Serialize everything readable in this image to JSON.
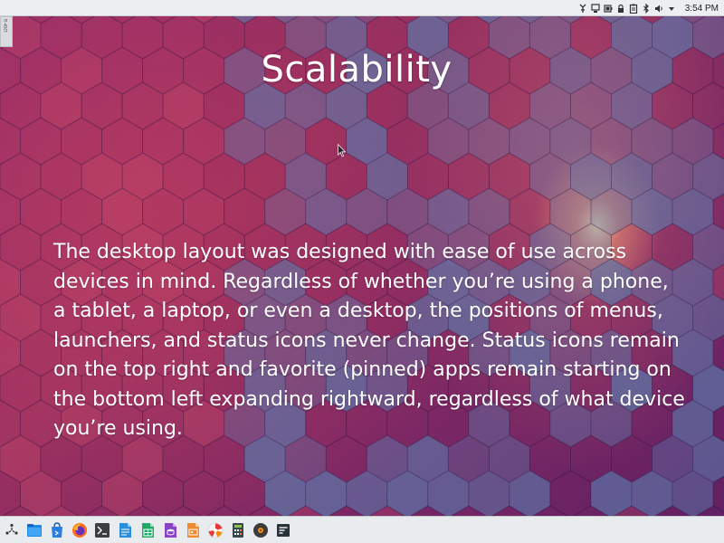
{
  "slide": {
    "title": "Scalability",
    "body": "The desktop layout was designed with ease of use across devices in mind. Regardless of whether you’re using a phone, a tablet, a laptop, or even a desktop, the positions of menus, launchers, and status icons never change. Status icons remain on the top right and favorite (pinned) apps remain starting on the bottom left expanding rightward, regardless of what device you’re using."
  },
  "top_panel": {
    "clock": "3:54 PM",
    "tray_icons": [
      "network-tool-icon",
      "device-icon",
      "battery-icon",
      "lock-icon",
      "clipboard-icon",
      "bluetooth-icon",
      "volume-icon",
      "dropdown-arrow-icon"
    ]
  },
  "edge_tab": {
    "label": "DoFa"
  },
  "dock": {
    "items": [
      {
        "icon": "launcher-menu-icon"
      },
      {
        "icon": "file-manager-icon"
      },
      {
        "icon": "package-manager-icon"
      },
      {
        "icon": "firefox-icon"
      },
      {
        "icon": "terminal-icon"
      },
      {
        "icon": "writer-document-icon"
      },
      {
        "icon": "spreadsheet-icon"
      },
      {
        "icon": "database-icon"
      },
      {
        "icon": "presentation-icon"
      },
      {
        "icon": "image-viewer-icon"
      },
      {
        "icon": "calculator-icon"
      },
      {
        "icon": "music-player-icon"
      },
      {
        "icon": "task-manager-icon"
      }
    ]
  },
  "colors": {
    "panel": "#eceff1",
    "dock": "#e9ecee",
    "wallpaper_primary": "#8f2a6a",
    "hex_tile": "#5d74a6",
    "text": "#ffffff"
  }
}
